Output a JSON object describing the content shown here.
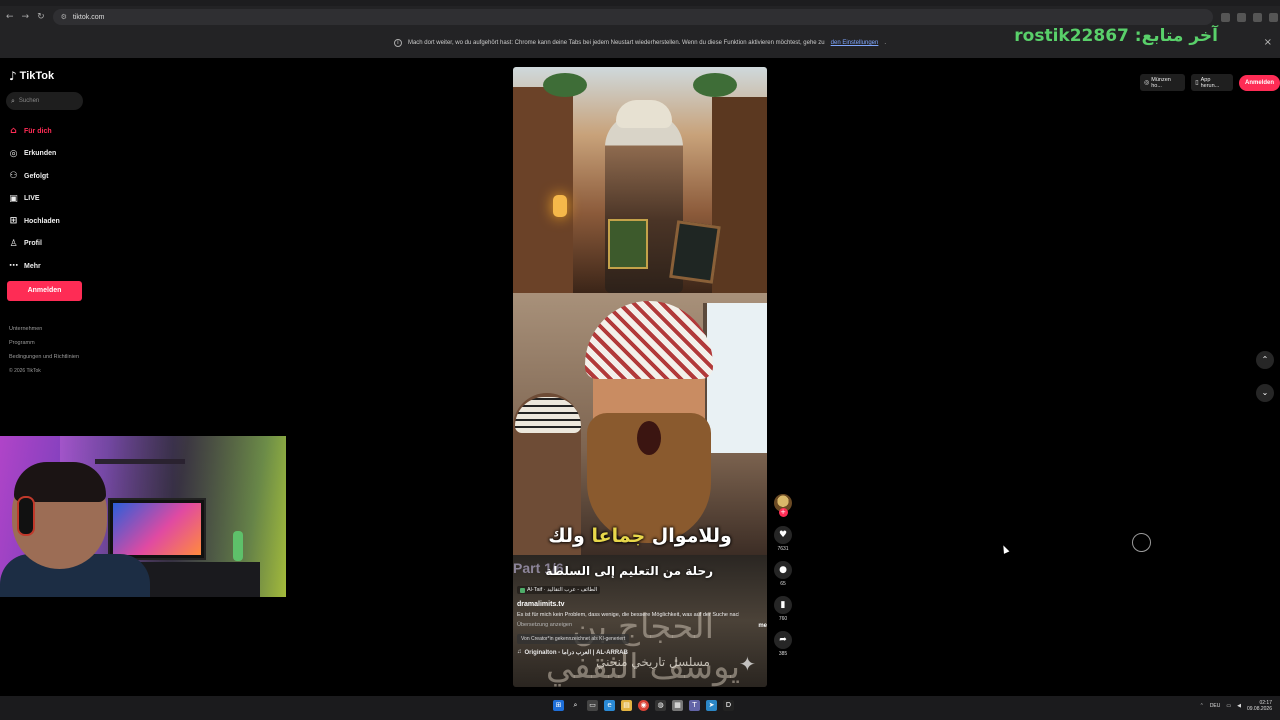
{
  "browser": {
    "url": "tiktok.com",
    "infobar_text": "Mach dort weiter, wo du aufgehört hast: Chrome kann deine Tabs bei jedem Neustart wiederherstellen. Wenn du diese Funktion aktivieren möchtest, gehe zu",
    "infobar_link": "den Einstellungen",
    "infobar_end": "."
  },
  "stream_overlay": {
    "last_follower": "rostik22867 :آخر متابع"
  },
  "sidebar": {
    "logo": "TikTok",
    "search_placeholder": "Suchen",
    "nav": [
      {
        "label": "Für dich",
        "icon": "home-icon",
        "glyph": "⌂"
      },
      {
        "label": "Erkunden",
        "icon": "compass-icon",
        "glyph": "◎"
      },
      {
        "label": "Gefolgt",
        "icon": "following-icon",
        "glyph": "⚇"
      },
      {
        "label": "LIVE",
        "icon": "live-icon",
        "glyph": "▣"
      },
      {
        "label": "Hochladen",
        "icon": "upload-icon",
        "glyph": "⊞"
      },
      {
        "label": "Profil",
        "icon": "profile-icon",
        "glyph": "♙"
      },
      {
        "label": "Mehr",
        "icon": "more-icon",
        "glyph": "⋯"
      }
    ],
    "login_label": "Anmelden",
    "footer": [
      "Unternehmen",
      "Programm",
      "Bedingungen und Richtlinien"
    ],
    "copyright": "© 2026 TikTok"
  },
  "header": {
    "coins_label": "Münzen ho...",
    "app_label": "App herun...",
    "login_label": "Anmelden"
  },
  "video": {
    "caption_main_before": "وللاموال ",
    "caption_main_highlight": "جماعا",
    "caption_main_after": " ولك",
    "caption_sub": "رحلة من التعليم إلى السلطة",
    "part_label": "Part 1/6",
    "location_tag": "Al-Taif · الطائف - عرب التقاليد",
    "author": "dramalimits.tv",
    "description": "Es ist für mich kein Problem, dass wenige, die bessere Möglichkeit, was auf der Suche nach",
    "more_label": "mehr",
    "translate_label": "Übersetzung anzeigen",
    "ai_label": "Von Creator*in gekennzeichnet als KI-generiert",
    "sound": "Originalton - العرب دراما | AL-ARRAB",
    "calligraphy": "الحجاج بن يوسف الثقفي",
    "series_label": "مسلسل تاريخي منحني"
  },
  "actions": {
    "likes": "7631",
    "comments": "65",
    "saves": "760",
    "shares": "385"
  },
  "taskbar": {
    "lang": "DEU",
    "time": "02:17",
    "date": "09.08.2026"
  }
}
